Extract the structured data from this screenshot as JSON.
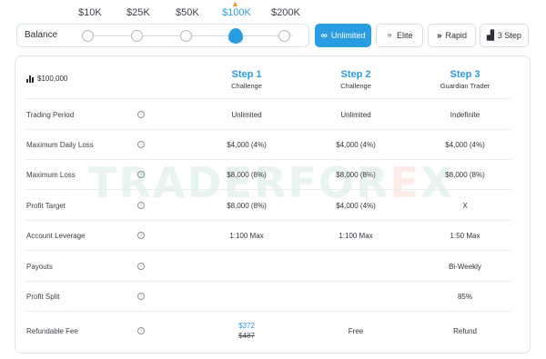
{
  "balance_options": [
    "$10K",
    "$25K",
    "$50K",
    "$100K",
    "$200K"
  ],
  "selected_balance": "$100K",
  "balance_label": "Balance",
  "plans": [
    {
      "label": "Unlimited",
      "icon": "infinity-icon",
      "glyph": "∞",
      "active": true
    },
    {
      "label": "Elite",
      "icon": "wings-icon",
      "glyph": "♅",
      "active": false
    },
    {
      "label": "Rapid",
      "icon": "fast-forward-icon",
      "glyph": "»",
      "active": false
    },
    {
      "label": "3 Step",
      "icon": "stairs-icon",
      "glyph": "▟",
      "active": false
    }
  ],
  "table": {
    "account_size": "$100,000",
    "steps": [
      {
        "title": "Step 1",
        "subtitle": "Challenge"
      },
      {
        "title": "Step 2",
        "subtitle": "Challenge"
      },
      {
        "title": "Step 3",
        "subtitle": "Guardian Trader"
      }
    ],
    "rows": [
      {
        "label": "Trading Period",
        "values": [
          "Unlimited",
          "Unlimited",
          "Indefinite"
        ]
      },
      {
        "label": "Maximum Daily Loss",
        "values": [
          "$4,000 (4%)",
          "$4,000 (4%)",
          "$4,000 (4%)"
        ]
      },
      {
        "label": "Maximum Loss",
        "values": [
          "$8,000 (8%)",
          "$8,000 (8%)",
          "$8,000 (8%)"
        ]
      },
      {
        "label": "Profit Target",
        "values": [
          "$8,000 (8%)",
          "$4,000 (4%)",
          "X"
        ]
      },
      {
        "label": "Account Leverage",
        "values": [
          "1:100 Max",
          "1:100 Max",
          "1:50 Max"
        ]
      },
      {
        "label": "Payouts",
        "values": [
          "",
          "",
          "Bi-Weekly"
        ]
      },
      {
        "label": "Profit Split",
        "values": [
          "",
          "",
          "85%"
        ]
      }
    ],
    "refundable_fee": {
      "label": "Refundable Fee",
      "price_new": "$372",
      "price_old": "$487",
      "step2": "Free",
      "step3": "Refund"
    }
  },
  "watermark": {
    "main": "TRADERFOR",
    "accent": "E",
    "tail": "X"
  },
  "colors": {
    "accent": "#2a9de0",
    "border": "#d7e6ef",
    "flame": "#f39b2a"
  }
}
